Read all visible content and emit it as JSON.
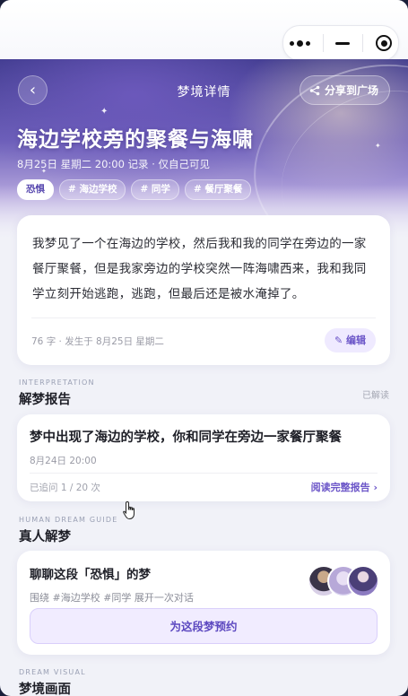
{
  "capsule": {
    "more_icon": "more-dots-icon",
    "minimize_icon": "minimize-icon",
    "close_icon": "target-circle-icon"
  },
  "nav": {
    "back_icon": "chevron-left-icon",
    "back_glyph": "‹",
    "title": "梦境详情",
    "share_label": "分享到广场",
    "share_icon": "share-icon"
  },
  "dream": {
    "title": "海边学校旁的聚餐与海啸",
    "meta": "8月25日 星期二 20:00 记录 · 仅自己可见",
    "tags": [
      "恐惧",
      "# 海边学校",
      "# 同学",
      "# 餐厅聚餐"
    ],
    "content": "我梦见了一个在海边的学校，然后我和我的同学在旁边的一家餐厅聚餐，但是我家旁边的学校突然一阵海啸西来，我和我同学立刻开始逃跑，逃跑，但最后还是被水淹掉了。",
    "stats": "76 字 · 发生于 8月25日 星期二",
    "edit_label": "✎ 编辑"
  },
  "interpretation": {
    "section_en": "INTERPRETATION",
    "section_cn": "解梦报告",
    "status": "已解读",
    "title": "梦中出现了海边的学校，你和同学在旁边一家餐厅聚餐",
    "date": "8月24日 20:00",
    "count": "已追问 1 / 20 次",
    "link": "阅读完整报告 ›"
  },
  "guide": {
    "section_en": "HUMAN DREAM GUIDE",
    "section_cn": "真人解梦",
    "title": "聊聊这段「恐惧」的梦",
    "subtitle": "围绕 #海边学校 #同学 展开一次对话",
    "book_label": "为这段梦预约"
  },
  "visual": {
    "section_en": "DREAM VISUAL",
    "section_cn": "梦境画面"
  },
  "colors": {
    "accent": "#6b55c8",
    "hero_top": "#3e3a8c",
    "page_bg": "#f1f2f8"
  }
}
